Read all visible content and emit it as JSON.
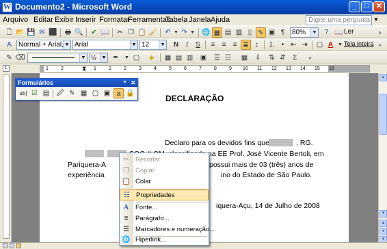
{
  "window": {
    "title": "Documento2 - Microsoft Word",
    "app_icon": "W"
  },
  "menubar": {
    "items": [
      "Arquivo",
      "Editar",
      "Exibir",
      "Inserir",
      "Formatar",
      "Ferramentas",
      "Tabela",
      "Janela",
      "Ajuda"
    ],
    "ask_placeholder": "Digite uma pergunta"
  },
  "standard_toolbar": {
    "zoom": "80%",
    "read_label": "Ler"
  },
  "formatting_toolbar": {
    "style": "Normal + Arial, Justi",
    "font": "Arial",
    "size": "12",
    "bold": "N",
    "italic": "I",
    "underline": "S",
    "font_color_label": "A",
    "full_screen_label": "Tela inteira"
  },
  "third_toolbar": {
    "half": "½"
  },
  "ruler": {
    "numbers": [
      "1",
      "2",
      "1",
      "1",
      "2",
      "3",
      "4",
      "5",
      "6",
      "7",
      "8",
      "9",
      "10",
      "11",
      "12",
      "13",
      "14",
      "15",
      "16"
    ]
  },
  "formularios": {
    "title": "Formulários",
    "first_tool": "ab|",
    "active_tool": "a"
  },
  "document": {
    "heading": "DECLARAÇÃO",
    "line1": "Declaro para os devidos fins que,",
    "line1_end": ", RG.",
    "line2_mid": "SOC-ILOM, classificada na EE Prof. José Vicente Bertoli, em",
    "line3_start": "Pariquera-A",
    "line3_end": "possui mais de 03 (três) anos de",
    "line4_start": "experiência",
    "line4_end": "ino do Estado de São Paulo.",
    "date_line": "iquera-Açu, 14 de Julho de 2008"
  },
  "context_menu": {
    "items": [
      {
        "label": "Recortar",
        "icon": "scissors-icon",
        "glyph": "✂",
        "disabled": true
      },
      {
        "label": "Copiar",
        "icon": "copy-icon",
        "glyph": "❐",
        "disabled": true
      },
      {
        "label": "Colar",
        "icon": "paste-icon",
        "glyph": "📋",
        "disabled": false
      },
      {
        "label": "Propriedades",
        "icon": "properties-icon",
        "glyph": "☷",
        "disabled": false,
        "selected": true
      },
      {
        "label": "Fonte...",
        "icon": "font-icon",
        "glyph": "A",
        "disabled": false
      },
      {
        "label": "Parágrafo...",
        "icon": "paragraph-icon",
        "glyph": "≡",
        "disabled": false
      },
      {
        "label": "Marcadores e numeração...",
        "icon": "bullets-icon",
        "glyph": "☰",
        "disabled": false
      },
      {
        "label": "Hiperlink...",
        "icon": "hyperlink-icon",
        "glyph": "🌐",
        "disabled": false
      }
    ]
  },
  "colors": {
    "title_bar": "#0a55cf",
    "selected_menu_item": "#fde9b0",
    "chrome": "#ece9d8"
  }
}
